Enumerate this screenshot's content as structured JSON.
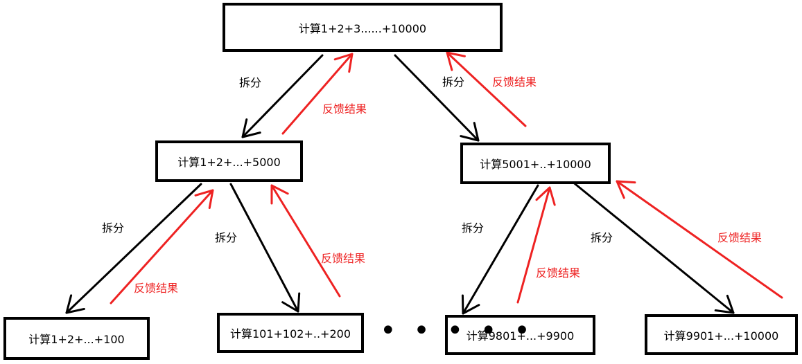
{
  "nodes": {
    "root": "计算1+2+3......+10000",
    "left": "计算1+2+...+5000",
    "right": "计算5001+..+10000",
    "ll": "计算1+2+...+100",
    "lr": "计算101+102+..+200",
    "rl": "计算9801+...+9900",
    "rr": "计算9901+...+10000"
  },
  "labels": {
    "split": "拆分",
    "feedback": "反馈结果"
  },
  "ellipsis": "• • • • •",
  "colors": {
    "split_arrow": "#000000",
    "feedback_arrow": "#ee2222",
    "feedback_text": "#ee2222"
  }
}
